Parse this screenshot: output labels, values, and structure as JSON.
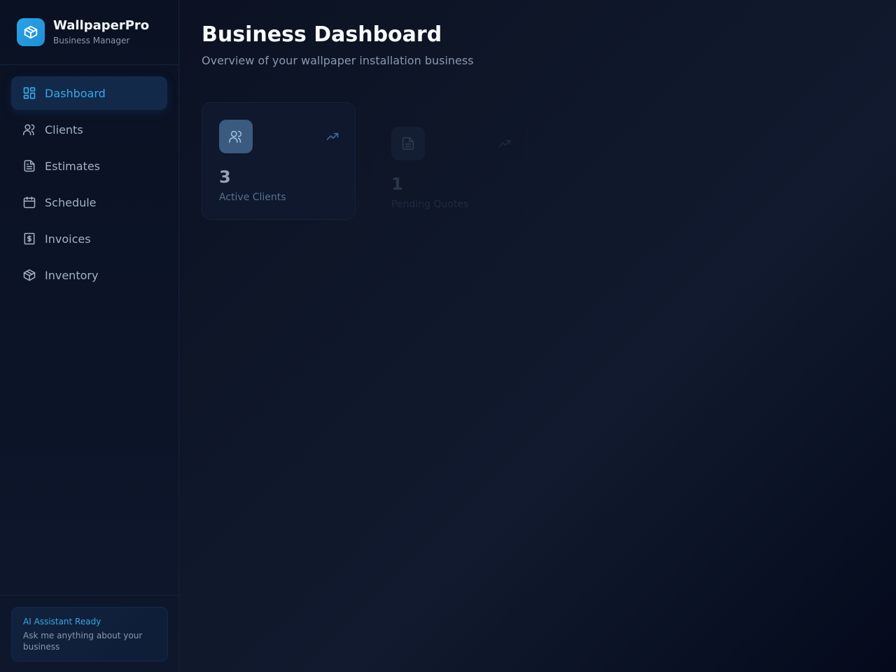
{
  "brand": {
    "name": "WallpaperPro",
    "tagline": "Business Manager"
  },
  "nav": [
    {
      "label": "Dashboard",
      "icon": "dashboard-icon",
      "active": true
    },
    {
      "label": "Clients",
      "icon": "users-icon"
    },
    {
      "label": "Estimates",
      "icon": "document-icon"
    },
    {
      "label": "Schedule",
      "icon": "calendar-icon"
    },
    {
      "label": "Invoices",
      "icon": "invoice-icon"
    },
    {
      "label": "Inventory",
      "icon": "package-icon"
    }
  ],
  "assistant": {
    "title": "AI Assistant Ready",
    "text": "Ask me anything about your business"
  },
  "header": {
    "title": "Business Dashboard",
    "subtitle": "Overview of your wallpaper installation business"
  },
  "stats": [
    {
      "value": "3",
      "label": "Active Clients",
      "icon": "users-icon"
    },
    {
      "value": "1",
      "label": "Pending Quotes",
      "icon": "document-icon"
    }
  ],
  "colors": {
    "accent": "#38a8e8",
    "background": "#0f172a",
    "card": "#0f182c"
  }
}
